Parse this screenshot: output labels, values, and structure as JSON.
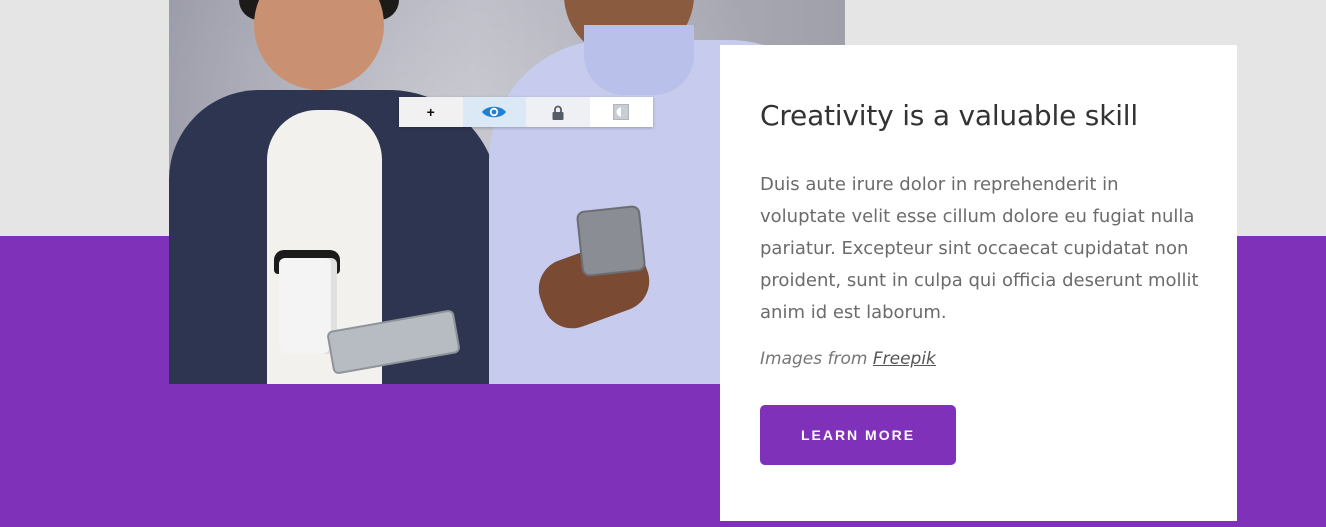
{
  "toolbar": {
    "add_label": "+",
    "tools": [
      "add",
      "eye-icon",
      "lock-icon",
      "contrast-icon"
    ]
  },
  "card": {
    "title": "Creativity is a valuable skill",
    "body": "Duis aute irure dolor in reprehenderit in voluptate velit esse cillum dolore eu fugiat nulla pariatur. Excepteur sint occaecat cupidatat non proident, sunt in culpa qui officia deserunt mollit anim id est laborum.",
    "credit_prefix": "Images from ",
    "credit_link": "Freepik",
    "button_label": "LEARN MORE"
  },
  "colors": {
    "accent": "#7f31b9",
    "page_background": "#e5e5e5",
    "card_background": "#ffffff",
    "icon_blue": "#1e7fd6"
  }
}
